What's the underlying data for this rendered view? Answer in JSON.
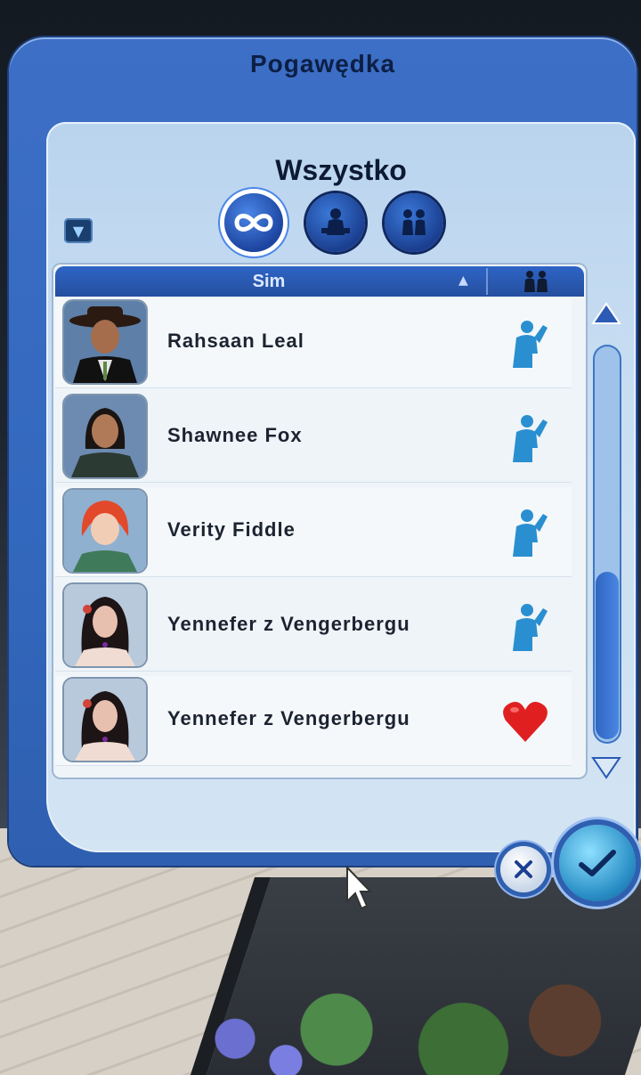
{
  "dialog": {
    "title": "Pogawędka",
    "filter_title": "Wszystko",
    "filters": [
      {
        "icon": "infinity-icon",
        "active": true
      },
      {
        "icon": "single-sim-icon",
        "active": false
      },
      {
        "icon": "couple-icon",
        "active": false
      }
    ],
    "list_header": {
      "sim_column": "Sim",
      "sort_indicator": "▲",
      "relationship_column_icon": "couple-icon"
    },
    "sims": [
      {
        "name": "Rahsaan Leal",
        "relationship_icon": "waving-sim-icon"
      },
      {
        "name": "Shawnee Fox",
        "relationship_icon": "waving-sim-icon"
      },
      {
        "name": "Verity Fiddle",
        "relationship_icon": "waving-sim-icon"
      },
      {
        "name": "Yennefer z Vengerbergu",
        "relationship_icon": "waving-sim-icon"
      },
      {
        "name": "Yennefer z Vengerbergu",
        "relationship_icon": "heart-icon"
      }
    ],
    "colors": {
      "panel": "#3268bd",
      "accent": "#2f66c2",
      "heart": "#e02020"
    }
  }
}
